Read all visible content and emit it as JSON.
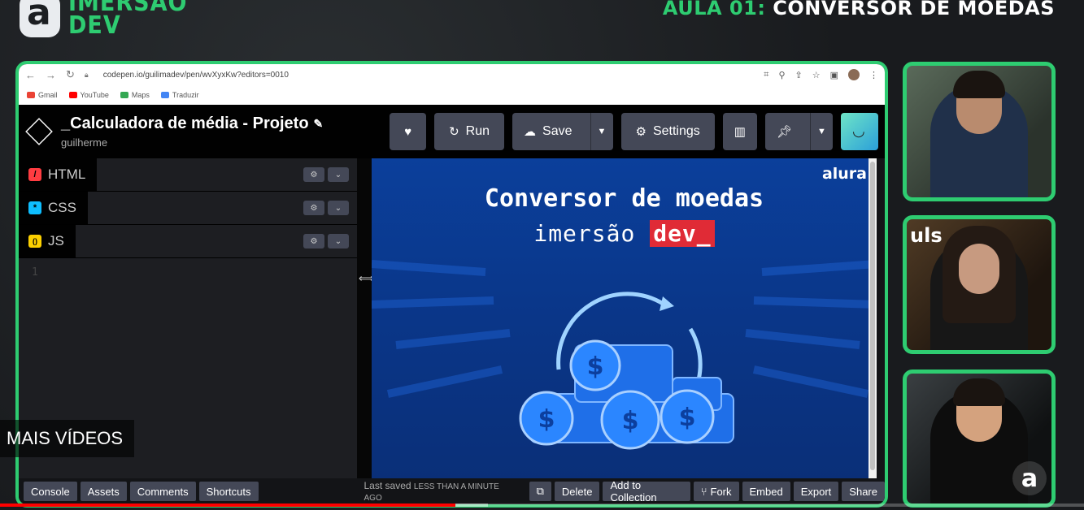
{
  "branding": {
    "title_line1": "IMERSÃO",
    "title_line2": "DEV"
  },
  "lesson": {
    "prefix": "AULA 01:",
    "name": "CONVERSOR DE MOEDAS"
  },
  "browser": {
    "url": "codepen.io/guilimadev/pen/wvXyxKw?editors=0010",
    "bookmarks": [
      {
        "label": "Gmail",
        "color": "#ea4335"
      },
      {
        "label": "YouTube",
        "color": "#ff0000"
      },
      {
        "label": "Maps",
        "color": "#34a853"
      },
      {
        "label": "Traduzir",
        "color": "#4285f4"
      }
    ]
  },
  "codepen": {
    "pen_title": "_Calculadora de média - Projeto",
    "author": "guilherme",
    "actions": {
      "run": "Run",
      "save": "Save",
      "settings": "Settings"
    },
    "editors": [
      {
        "label": "HTML",
        "icon_color": "#ff3c41",
        "icon": "/"
      },
      {
        "label": "CSS",
        "icon_color": "#0ebeff",
        "icon": "*"
      },
      {
        "label": "JS",
        "icon_color": "#fcd000",
        "icon": "()"
      }
    ],
    "line_number": "1",
    "footer_left": [
      "Console",
      "Assets",
      "Comments",
      "Shortcuts"
    ],
    "last_saved_label": "Last saved",
    "last_saved_time": "LESS THAN A MINUTE AGO",
    "footer_right": [
      "Delete",
      "Add to Collection",
      "Fork",
      "Embed",
      "Export",
      "Share"
    ]
  },
  "preview": {
    "logo": "alura",
    "title": "Conversor de moedas",
    "sub_prefix": "imersão",
    "sub_highlight": "dev_"
  },
  "video": {
    "more_videos": "MAIS VÍDEOS",
    "progress": 0.42,
    "corner_logo": "a"
  },
  "cam2_overlay": "uls"
}
